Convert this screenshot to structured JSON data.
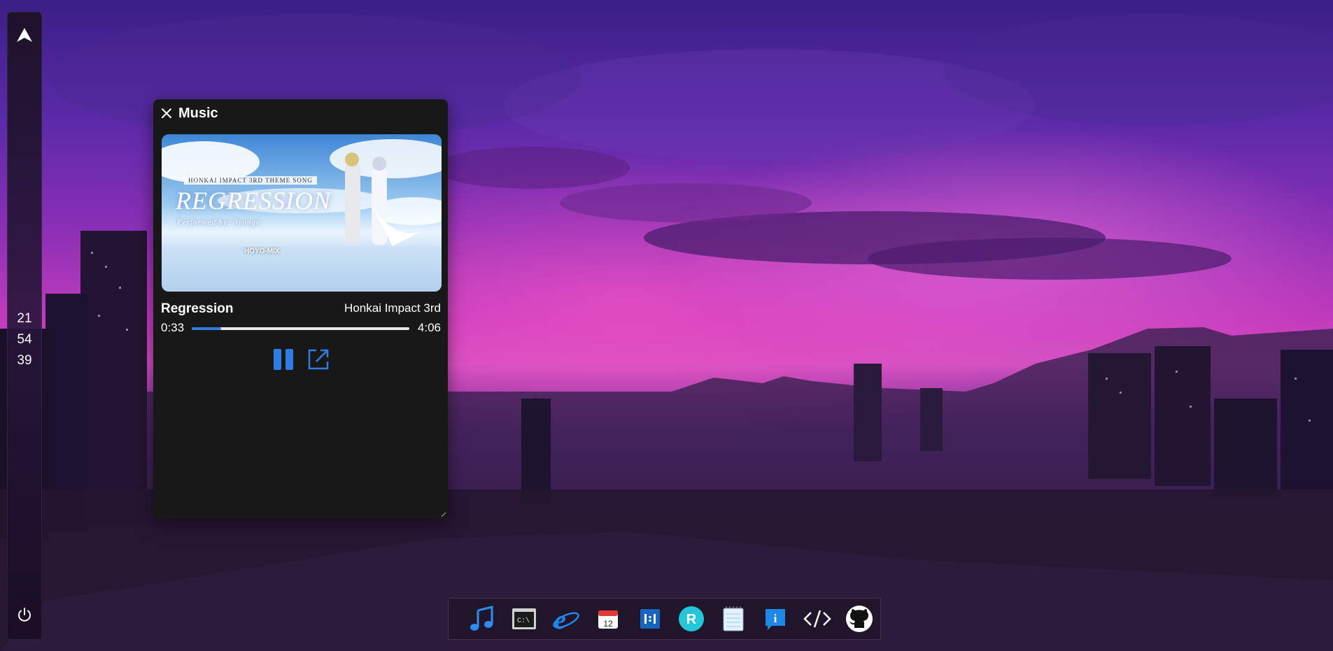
{
  "sidebar": {
    "clock": {
      "hours": "21",
      "minutes": "54",
      "seconds": "39"
    }
  },
  "music": {
    "window_title": "Music",
    "cover": {
      "line1": "HONKAI IMPACT 3RD THEME SONG",
      "title": "REGRESSION",
      "performer": "Performed by: Ayanga",
      "brand": "HOYO-MIX"
    },
    "song_title": "Regression",
    "artist": "Honkai Impact 3rd",
    "time_current": "0:33",
    "time_total": "4:06",
    "progress_fraction": 0.134,
    "accent_color": "#2f7de1"
  },
  "dock": {
    "items": [
      {
        "name": "music-icon"
      },
      {
        "name": "terminal-icon",
        "label": "C:\\"
      },
      {
        "name": "internet-explorer-icon"
      },
      {
        "name": "calendar-icon",
        "label": "12"
      },
      {
        "name": "app-1i1-icon"
      },
      {
        "name": "r-app-icon",
        "label": "R"
      },
      {
        "name": "notepad-icon"
      },
      {
        "name": "info-icon",
        "label": "i"
      },
      {
        "name": "code-icon"
      },
      {
        "name": "github-icon"
      }
    ]
  }
}
